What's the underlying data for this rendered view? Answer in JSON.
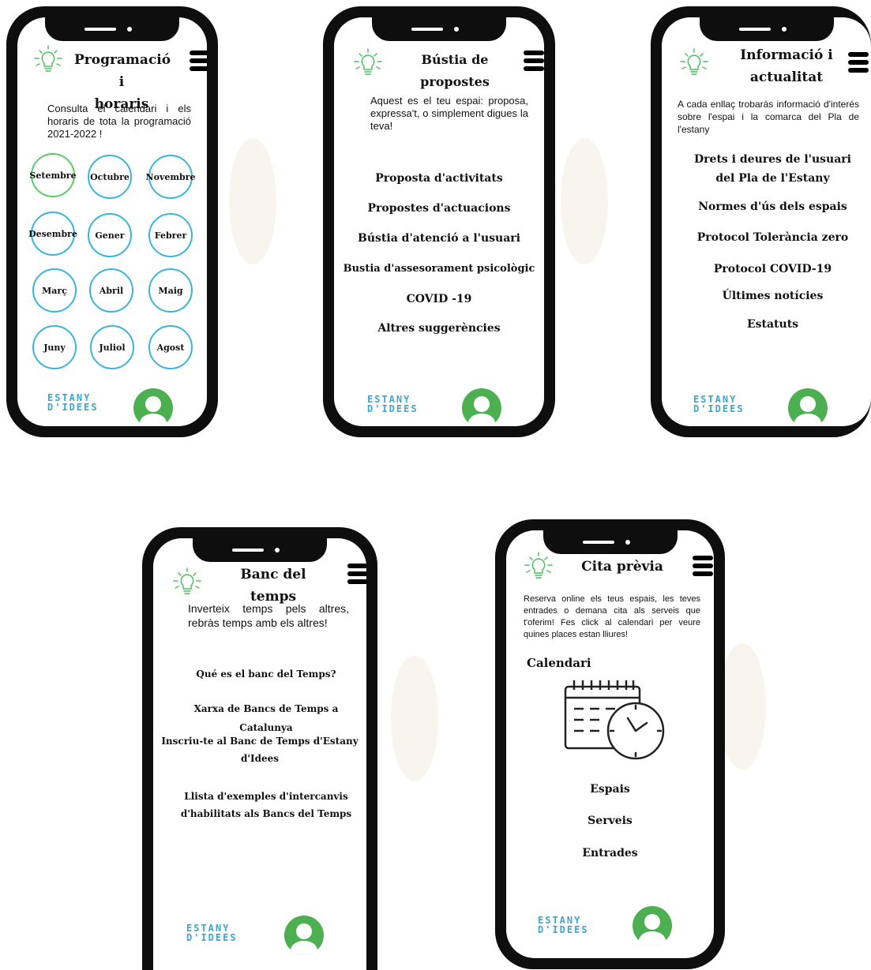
{
  "brand": {
    "logo_line1": "ESTANY",
    "logo_line2": "D'IDEES"
  },
  "screen1": {
    "title_line1": "Programació i",
    "title_line2": "horaris",
    "intro": "Consulta el calendari i els horaris de tota la programació 2021-2022 !",
    "months": [
      "Setembre",
      "Octubre",
      "Novembre",
      "Desembre",
      "Gener",
      "Febrer",
      "Març",
      "Abril",
      "Maig",
      "Juny",
      "Juliol",
      "Agost"
    ],
    "active_month": "Setembre"
  },
  "screen2": {
    "title": "Bústia de propostes",
    "intro": "Aquest es el teu espai: proposa, expressa't, o simplement digues la teva!",
    "links": [
      "Proposta d'activitats",
      "Propostes d'actuacions",
      "Bústia d'atenció a l'usuari",
      "Bustia d'assesorament psicològic",
      "COVID -19",
      "Altres suggerències"
    ]
  },
  "screen3": {
    "title_line1": "Informació i",
    "title_line2": "actualitat",
    "intro": "A cada enllaç trobaràs informació d'interés sobre l'espai i la comarca del Pla de l'estany",
    "link1_line1": "Drets i deures de l'usuari",
    "link1_line2": "del Pla de l'Estany",
    "links": [
      "Normes d'ús dels espais",
      "Protocol Tolerància zero",
      "Protocol COVID-19",
      "Últimes notícies",
      "Estatuts"
    ]
  },
  "screen4": {
    "title": "Banc del temps",
    "intro": "Inverteix temps pels altres, rebràs temps amb els altres!",
    "link1": "Qué es el banc del Temps?",
    "link2": "Xarxa de Bancs de Temps a Catalunya",
    "link3_line1": "Inscriu-te al Banc de Temps d'Estany",
    "link3_line2": "d'Idees",
    "link4_line1": "Llista d'exemples d'intercanvis",
    "link4_line2": "d'habilitats als Bancs del Temps"
  },
  "screen5": {
    "title": "Cita prèvia",
    "intro": "Reserva online els teus espais, les teves entrades o demana cita als serveis que t'oferim! Fes click al calendari per veure quines places estan lliures!",
    "calendar_label": "Calendari",
    "links": [
      "Espais",
      "Serveis",
      "Entrades"
    ]
  },
  "colors": {
    "phone": "#0e0e0e",
    "month_border": "#3ab4dc",
    "month_active": "#5cc96a",
    "avatar": "#4caf50",
    "logo": "#3aa6cf"
  }
}
